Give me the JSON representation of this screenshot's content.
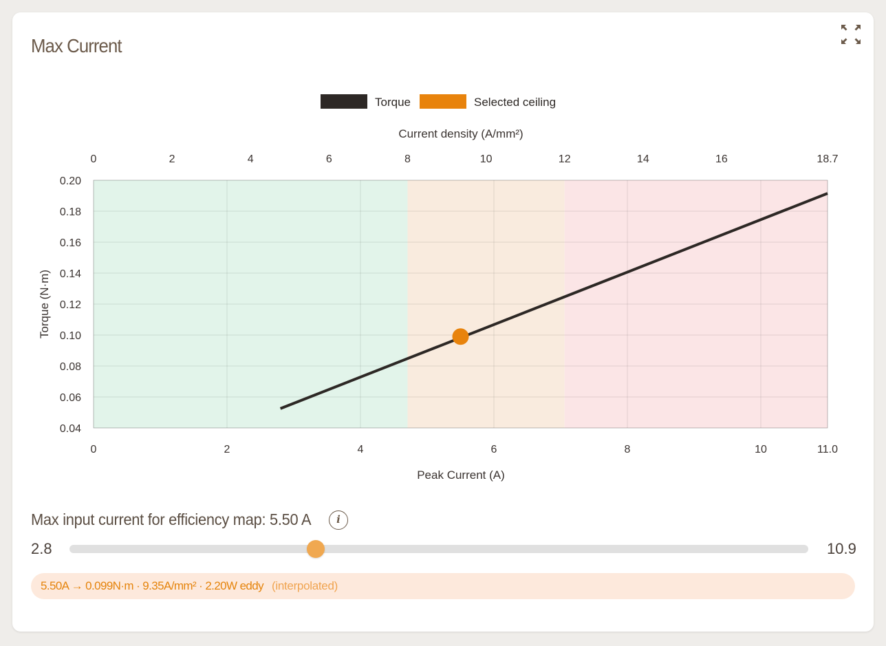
{
  "card": {
    "title": "Max Current"
  },
  "chart_data": {
    "type": "line",
    "legend": {
      "placement": "top-center",
      "entries": [
        {
          "label": "Torque",
          "color": "#2d2825"
        },
        {
          "label": "Selected ceiling",
          "color": "#e8830c"
        }
      ]
    },
    "xlabel": "Peak Current (A)",
    "ylabel": "Torque (N·m)",
    "x2label": "Current density (A/mm²)",
    "xlim": [
      0,
      11.0
    ],
    "ylim": [
      0.04,
      0.2
    ],
    "x_ticks": [
      "0",
      "2",
      "4",
      "6",
      "8",
      "10",
      "11.0"
    ],
    "y_ticks": [
      "0.20",
      "0.18",
      "0.16",
      "0.14",
      "0.12",
      "0.10",
      "0.08",
      "0.06",
      "0.04"
    ],
    "x2_ticks": [
      "0",
      "2",
      "4",
      "6",
      "8",
      "10",
      "12",
      "14",
      "16",
      "18.7"
    ],
    "grid": true,
    "series": [
      {
        "name": "Torque",
        "color": "#2d2825",
        "x": [
          2.8,
          11.0
        ],
        "y": [
          0.0525,
          0.1915
        ]
      }
    ],
    "selected_point": {
      "x": 5.5,
      "y": 0.099,
      "color": "#e8830c"
    },
    "zones": [
      {
        "from": 0,
        "to": 8,
        "color": "#e2f4ea"
      },
      {
        "from": 8,
        "to": 12,
        "color": "#f9ebde"
      },
      {
        "from": 12,
        "to": 18.7,
        "color": "#fbe5e6"
      }
    ]
  },
  "slider": {
    "label": "Max input current for efficiency map: 5.50 A",
    "min_label": "2.8",
    "max_label": "10.9",
    "min": 2.8,
    "max": 10.9,
    "value": 5.5
  },
  "info_icon": "info-icon",
  "expand_icon": "expand-icon",
  "summary": {
    "main": "5.50A → 0.099N·m · 9.35A/mm² · 2.20W eddy",
    "note": "(interpolated)"
  }
}
